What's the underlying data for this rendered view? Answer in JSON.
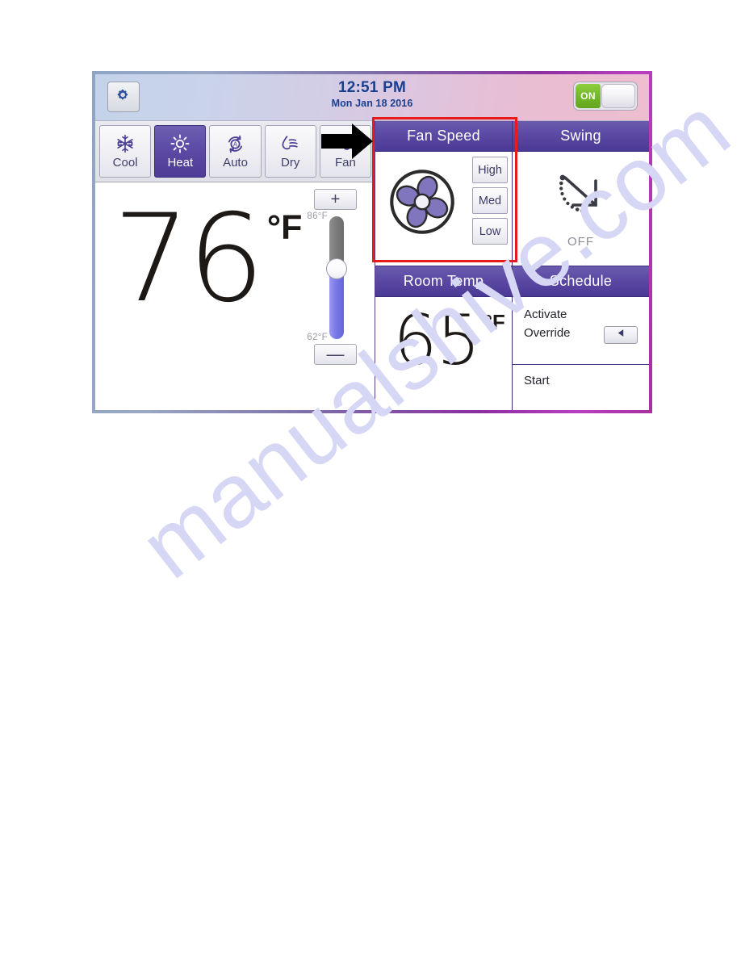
{
  "statusbar": {
    "settings_icon": "gear-icon",
    "time": "12:51 PM",
    "date": "Mon Jan 18 2016",
    "power_toggle_label": "ON",
    "power_toggle_state": "on",
    "toggle_on_color": "#72b62a"
  },
  "modes": [
    {
      "label": "Cool",
      "icon": "snowflake-icon",
      "selected": false
    },
    {
      "label": "Heat",
      "icon": "sun-icon",
      "selected": true
    },
    {
      "label": "Auto",
      "icon": "auto-circle-icon",
      "selected": false
    },
    {
      "label": "Dry",
      "icon": "droplet-waves-icon",
      "selected": false
    },
    {
      "label": "Fan",
      "icon": "fan-blade-icon",
      "selected": false
    }
  ],
  "setpoint": {
    "value": "76",
    "unit": "°F",
    "plus_label": "+",
    "minus_label": "—",
    "max_label": "86°F",
    "min_label": "62°F"
  },
  "panels": {
    "fan_speed": {
      "title": "Fan Speed",
      "icon": "fan-icon",
      "options": [
        "High",
        "Med",
        "Low"
      ],
      "selected": null
    },
    "swing": {
      "title": "Swing",
      "icon": "swing-arc-icon",
      "state": "OFF"
    },
    "room_temp": {
      "title": "Room Temp",
      "value": "65",
      "unit": "°F"
    },
    "schedule": {
      "title": "Schedule",
      "line1": "Activate",
      "line2": "Override",
      "override_arrow_icon": "triangle-left-icon",
      "start_label": "Start"
    }
  },
  "annotations": {
    "fan_speed_highlight_color": "#e81b1b",
    "pointer_arrow_icon": "arrow-right-icon"
  },
  "watermark": {
    "text": "manualshive.com"
  }
}
